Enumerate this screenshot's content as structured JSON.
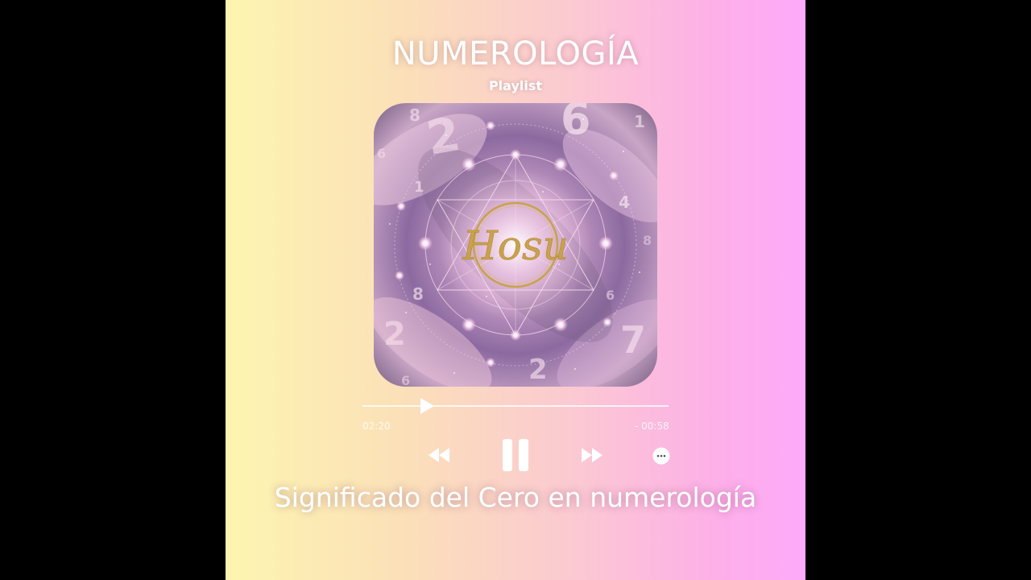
{
  "player": {
    "title": "NUMEROLOGÍA",
    "subtitle": "Playlist",
    "cover": {
      "logo_text": "Hosu",
      "numbers": [
        "8",
        "2",
        "6",
        "6",
        "1",
        "6",
        "1",
        "4",
        "8",
        "8",
        "6",
        "8",
        "2",
        "6",
        "2",
        "7"
      ]
    },
    "progress": {
      "fraction": 0.22,
      "elapsed": "02:20",
      "remaining": "- 00:58"
    },
    "controls": {
      "rewind_icon": "rewind-icon",
      "pause_icon": "pause-icon",
      "forward_icon": "fast-forward-icon",
      "more_icon": "more-options-icon"
    },
    "song_title": "Significado del Cero en numerología"
  },
  "colors": {
    "gradient_start": "#fdf5b0",
    "gradient_end": "#fdaafa",
    "text": "#ffffff"
  }
}
